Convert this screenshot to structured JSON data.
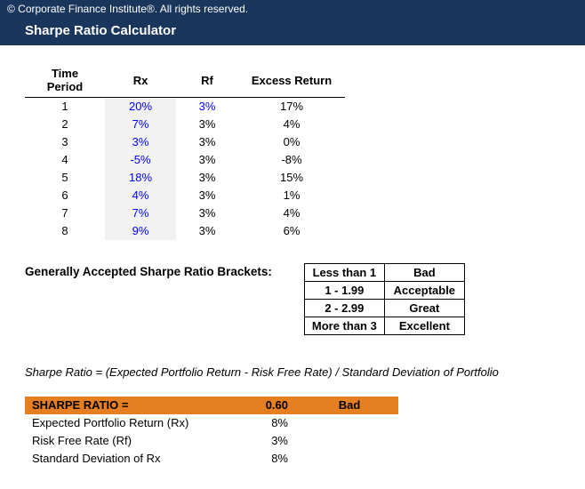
{
  "header": {
    "copyright": "© Corporate Finance Institute®. All rights reserved.",
    "title": "Sharpe Ratio Calculator"
  },
  "columns": {
    "time_period": "Time Period",
    "rx": "Rx",
    "rf": "Rf",
    "excess_return": "Excess Return"
  },
  "rows": [
    {
      "period": "1",
      "rx": "20%",
      "rf": "3%",
      "er": "17%"
    },
    {
      "period": "2",
      "rx": "7%",
      "rf": "3%",
      "er": "4%"
    },
    {
      "period": "3",
      "rx": "3%",
      "rf": "3%",
      "er": "0%"
    },
    {
      "period": "4",
      "rx": "-5%",
      "rf": "3%",
      "er": "-8%"
    },
    {
      "period": "5",
      "rx": "18%",
      "rf": "3%",
      "er": "15%"
    },
    {
      "period": "6",
      "rx": "4%",
      "rf": "3%",
      "er": "1%"
    },
    {
      "period": "7",
      "rx": "7%",
      "rf": "3%",
      "er": "4%"
    },
    {
      "period": "8",
      "rx": "9%",
      "rf": "3%",
      "er": "6%"
    }
  ],
  "brackets": {
    "label": "Generally Accepted Sharpe Ratio Brackets:",
    "items": [
      {
        "range": "Less than 1",
        "rating": "Bad"
      },
      {
        "range": "1 - 1.99",
        "rating": "Acceptable"
      },
      {
        "range": "2 - 2.99",
        "rating": "Great"
      },
      {
        "range": "More than 3",
        "rating": "Excellent"
      }
    ]
  },
  "formula": "Sharpe Ratio = (Expected Portfolio Return - Risk Free Rate) / Standard Deviation of Portfolio",
  "result": {
    "header_label": "SHARPE RATIO =",
    "value": "0.60",
    "rating": "Bad",
    "lines": [
      {
        "label": "Expected Portfolio Return (Rx)",
        "value": "8%"
      },
      {
        "label": "Risk Free Rate (Rf)",
        "value": "3%"
      },
      {
        "label": "Standard Deviation of Rx",
        "value": "8%"
      }
    ]
  },
  "chart_data": {
    "type": "table",
    "title": "Sharpe Ratio Calculator",
    "columns": [
      "Time Period",
      "Rx",
      "Rf",
      "Excess Return"
    ],
    "data": [
      [
        1,
        0.2,
        0.03,
        0.17
      ],
      [
        2,
        0.07,
        0.03,
        0.04
      ],
      [
        3,
        0.03,
        0.03,
        0.0
      ],
      [
        4,
        -0.05,
        0.03,
        -0.08
      ],
      [
        5,
        0.18,
        0.03,
        0.15
      ],
      [
        6,
        0.04,
        0.03,
        0.01
      ],
      [
        7,
        0.07,
        0.03,
        0.04
      ],
      [
        8,
        0.09,
        0.03,
        0.06
      ]
    ],
    "summary": {
      "expected_portfolio_return": 0.08,
      "risk_free_rate": 0.03,
      "std_dev_rx": 0.08,
      "sharpe_ratio": 0.6,
      "rating": "Bad"
    }
  }
}
